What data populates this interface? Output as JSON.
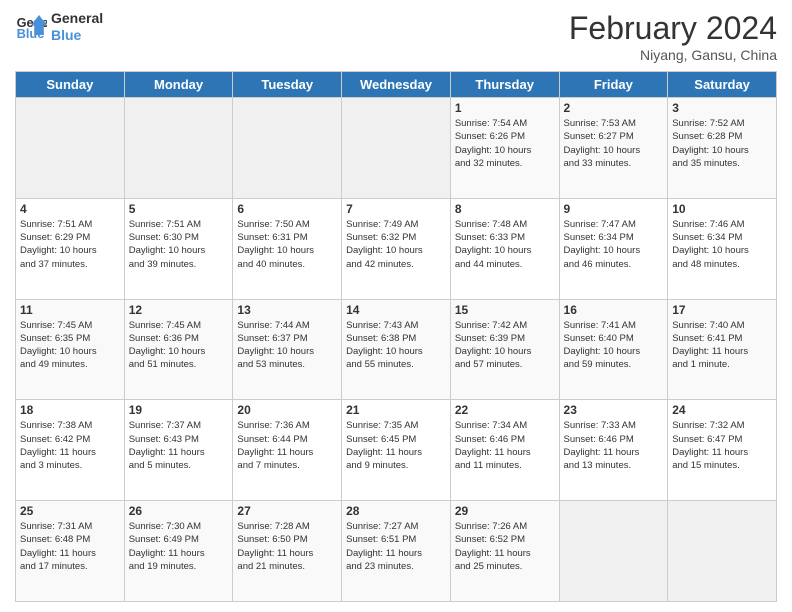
{
  "logo": {
    "line1": "General",
    "line2": "Blue"
  },
  "title": "February 2024",
  "subtitle": "Niyang, Gansu, China",
  "weekdays": [
    "Sunday",
    "Monday",
    "Tuesday",
    "Wednesday",
    "Thursday",
    "Friday",
    "Saturday"
  ],
  "weeks": [
    [
      {
        "day": "",
        "info": ""
      },
      {
        "day": "",
        "info": ""
      },
      {
        "day": "",
        "info": ""
      },
      {
        "day": "",
        "info": ""
      },
      {
        "day": "1",
        "info": "Sunrise: 7:54 AM\nSunset: 6:26 PM\nDaylight: 10 hours\nand 32 minutes."
      },
      {
        "day": "2",
        "info": "Sunrise: 7:53 AM\nSunset: 6:27 PM\nDaylight: 10 hours\nand 33 minutes."
      },
      {
        "day": "3",
        "info": "Sunrise: 7:52 AM\nSunset: 6:28 PM\nDaylight: 10 hours\nand 35 minutes."
      }
    ],
    [
      {
        "day": "4",
        "info": "Sunrise: 7:51 AM\nSunset: 6:29 PM\nDaylight: 10 hours\nand 37 minutes."
      },
      {
        "day": "5",
        "info": "Sunrise: 7:51 AM\nSunset: 6:30 PM\nDaylight: 10 hours\nand 39 minutes."
      },
      {
        "day": "6",
        "info": "Sunrise: 7:50 AM\nSunset: 6:31 PM\nDaylight: 10 hours\nand 40 minutes."
      },
      {
        "day": "7",
        "info": "Sunrise: 7:49 AM\nSunset: 6:32 PM\nDaylight: 10 hours\nand 42 minutes."
      },
      {
        "day": "8",
        "info": "Sunrise: 7:48 AM\nSunset: 6:33 PM\nDaylight: 10 hours\nand 44 minutes."
      },
      {
        "day": "9",
        "info": "Sunrise: 7:47 AM\nSunset: 6:34 PM\nDaylight: 10 hours\nand 46 minutes."
      },
      {
        "day": "10",
        "info": "Sunrise: 7:46 AM\nSunset: 6:34 PM\nDaylight: 10 hours\nand 48 minutes."
      }
    ],
    [
      {
        "day": "11",
        "info": "Sunrise: 7:45 AM\nSunset: 6:35 PM\nDaylight: 10 hours\nand 49 minutes."
      },
      {
        "day": "12",
        "info": "Sunrise: 7:45 AM\nSunset: 6:36 PM\nDaylight: 10 hours\nand 51 minutes."
      },
      {
        "day": "13",
        "info": "Sunrise: 7:44 AM\nSunset: 6:37 PM\nDaylight: 10 hours\nand 53 minutes."
      },
      {
        "day": "14",
        "info": "Sunrise: 7:43 AM\nSunset: 6:38 PM\nDaylight: 10 hours\nand 55 minutes."
      },
      {
        "day": "15",
        "info": "Sunrise: 7:42 AM\nSunset: 6:39 PM\nDaylight: 10 hours\nand 57 minutes."
      },
      {
        "day": "16",
        "info": "Sunrise: 7:41 AM\nSunset: 6:40 PM\nDaylight: 10 hours\nand 59 minutes."
      },
      {
        "day": "17",
        "info": "Sunrise: 7:40 AM\nSunset: 6:41 PM\nDaylight: 11 hours\nand 1 minute."
      }
    ],
    [
      {
        "day": "18",
        "info": "Sunrise: 7:38 AM\nSunset: 6:42 PM\nDaylight: 11 hours\nand 3 minutes."
      },
      {
        "day": "19",
        "info": "Sunrise: 7:37 AM\nSunset: 6:43 PM\nDaylight: 11 hours\nand 5 minutes."
      },
      {
        "day": "20",
        "info": "Sunrise: 7:36 AM\nSunset: 6:44 PM\nDaylight: 11 hours\nand 7 minutes."
      },
      {
        "day": "21",
        "info": "Sunrise: 7:35 AM\nSunset: 6:45 PM\nDaylight: 11 hours\nand 9 minutes."
      },
      {
        "day": "22",
        "info": "Sunrise: 7:34 AM\nSunset: 6:46 PM\nDaylight: 11 hours\nand 11 minutes."
      },
      {
        "day": "23",
        "info": "Sunrise: 7:33 AM\nSunset: 6:46 PM\nDaylight: 11 hours\nand 13 minutes."
      },
      {
        "day": "24",
        "info": "Sunrise: 7:32 AM\nSunset: 6:47 PM\nDaylight: 11 hours\nand 15 minutes."
      }
    ],
    [
      {
        "day": "25",
        "info": "Sunrise: 7:31 AM\nSunset: 6:48 PM\nDaylight: 11 hours\nand 17 minutes."
      },
      {
        "day": "26",
        "info": "Sunrise: 7:30 AM\nSunset: 6:49 PM\nDaylight: 11 hours\nand 19 minutes."
      },
      {
        "day": "27",
        "info": "Sunrise: 7:28 AM\nSunset: 6:50 PM\nDaylight: 11 hours\nand 21 minutes."
      },
      {
        "day": "28",
        "info": "Sunrise: 7:27 AM\nSunset: 6:51 PM\nDaylight: 11 hours\nand 23 minutes."
      },
      {
        "day": "29",
        "info": "Sunrise: 7:26 AM\nSunset: 6:52 PM\nDaylight: 11 hours\nand 25 minutes."
      },
      {
        "day": "",
        "info": ""
      },
      {
        "day": "",
        "info": ""
      }
    ]
  ]
}
